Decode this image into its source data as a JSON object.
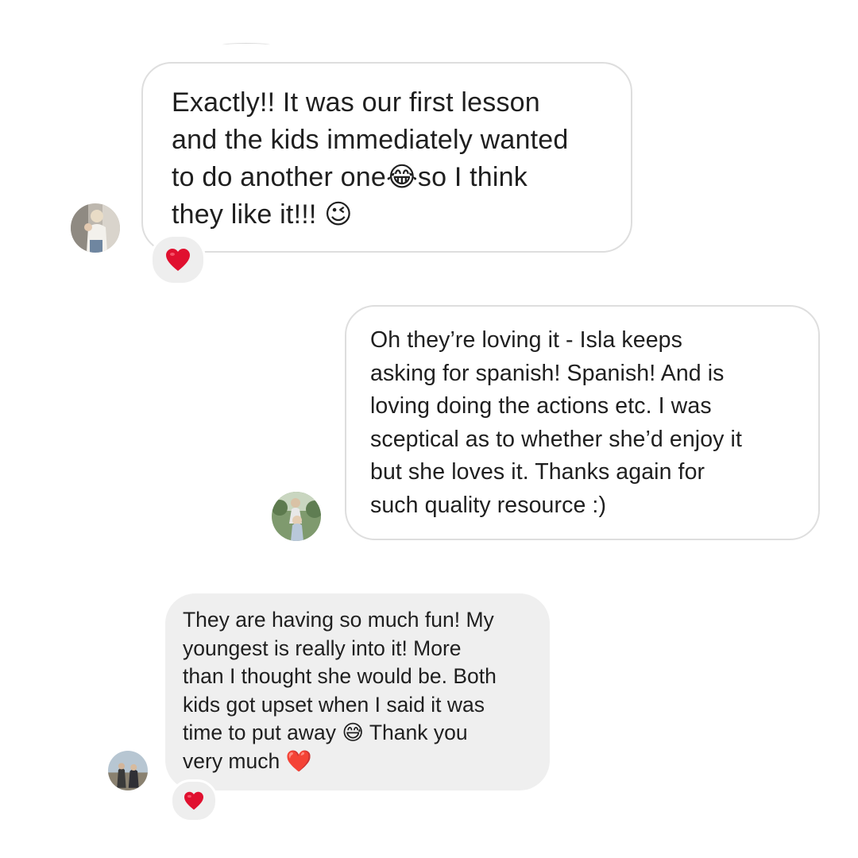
{
  "messages": [
    {
      "sender": "other",
      "text": "Exactly!! It was our first lesson\nand the kids immediately wanted\nto do another one😂so I think\nthey like it!!! 😉",
      "reaction": "❤️"
    },
    {
      "sender": "self",
      "text": "Oh they’re loving it - Isla keeps\nasking for spanish! Spanish! And is\nloving doing the actions etc. I was\nsceptical as to whether she’d enjoy it\nbut she loves it. Thanks again for\nsuch quality resource :)",
      "reaction": ""
    },
    {
      "sender": "other",
      "text": "They are having so much fun! My\nyoungest is really into it! More\nthan I thought she would be. Both\nkids got upset when I said it was\ntime to put away 😅 Thank you\nvery much ❤️",
      "reaction": "❤️"
    }
  ],
  "colors": {
    "heart": "#e0102f",
    "bubble_border": "#dedede",
    "bubble_fill": "#efefef",
    "text": "#1f1f1f"
  }
}
